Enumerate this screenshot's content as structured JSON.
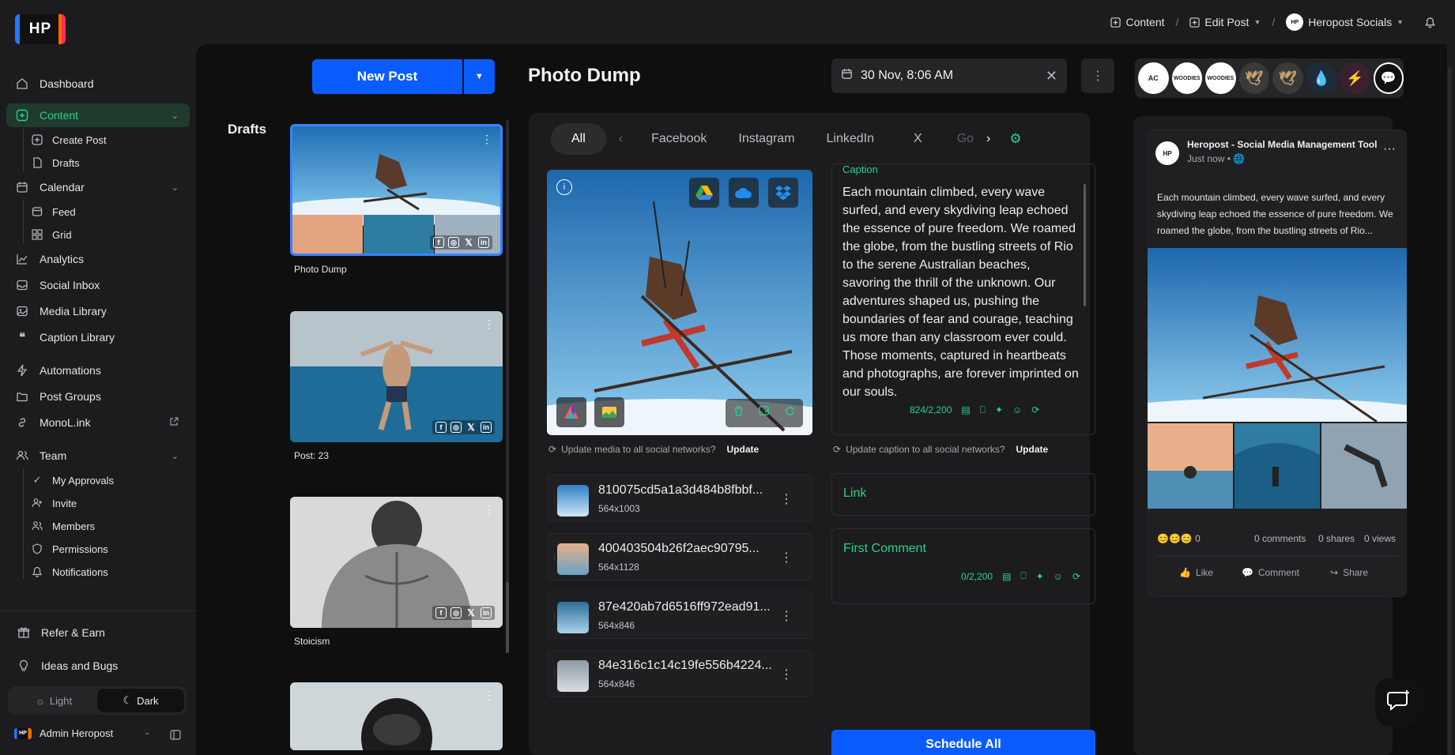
{
  "logo": "HP",
  "header": {
    "crumbs": [
      "Content",
      "Edit Post",
      "Heropost Socials"
    ]
  },
  "sidebar": {
    "items": [
      {
        "label": "Dashboard"
      },
      {
        "label": "Content"
      },
      {
        "label": "Create Post"
      },
      {
        "label": "Drafts"
      },
      {
        "label": "Calendar"
      },
      {
        "label": "Feed"
      },
      {
        "label": "Grid"
      },
      {
        "label": "Analytics"
      },
      {
        "label": "Social Inbox"
      },
      {
        "label": "Media Library"
      },
      {
        "label": "Caption Library"
      },
      {
        "label": "Automations"
      },
      {
        "label": "Post Groups"
      },
      {
        "label": "MonoL.ink"
      },
      {
        "label": "Team"
      },
      {
        "label": "My Approvals"
      },
      {
        "label": "Invite"
      },
      {
        "label": "Members"
      },
      {
        "label": "Permissions"
      },
      {
        "label": "Notifications"
      },
      {
        "label": "Refer & Earn"
      },
      {
        "label": "Ideas and Bugs"
      }
    ],
    "theme": {
      "light": "Light",
      "dark": "Dark"
    },
    "user": {
      "name": "Admin Heropost",
      "badge": "HP"
    }
  },
  "toolbar": {
    "new_post": "New Post",
    "post_title": "Photo Dump",
    "date": "30 Nov, 8:06 AM"
  },
  "drafts": {
    "title": "Drafts",
    "items": [
      {
        "label": "Photo Dump"
      },
      {
        "label": "Post: 23"
      },
      {
        "label": "Stoicism"
      }
    ]
  },
  "avatars": [
    "AC",
    "WOODIES",
    "WOODIES",
    "",
    "",
    "",
    "",
    ""
  ],
  "tabs": [
    "All",
    "Facebook",
    "Instagram",
    "LinkedIn",
    "X",
    "Go"
  ],
  "media": {
    "update_prompt": "Update media to all social networks?",
    "update_label": "Update",
    "items": [
      {
        "name": "810075cd5a1a3d484b8fbbf...",
        "dims": "564x1003"
      },
      {
        "name": "400403504b26f2aec90795...",
        "dims": "564x1128"
      },
      {
        "name": "87e420ab7d6516ff972ead91...",
        "dims": "564x846"
      },
      {
        "name": "84e316c1c14c19fe556b4224...",
        "dims": "564x846"
      }
    ]
  },
  "caption": {
    "label": "Caption",
    "text": "Each mountain climbed, every wave surfed, and every skydiving leap echoed the essence of pure freedom. We roamed the globe, from the bustling streets of Rio to the serene Australian beaches, savoring the thrill of the unknown. Our adventures shaped us, pushing the boundaries of fear and courage, teaching us more than any classroom ever could. Those moments, captured in heartbeats and photographs, are forever imprinted on our souls.",
    "count": "824/2,200",
    "update_prompt": "Update caption to all social networks?",
    "update_label": "Update"
  },
  "link": {
    "label": "Link"
  },
  "first_comment": {
    "label": "First Comment",
    "count": "0/2,200"
  },
  "schedule": "Schedule All",
  "preview": {
    "account": "Heropost - Social Media Management Tool",
    "time": "Just now •",
    "text": "Each mountain climbed, every wave surfed, and every skydiving leap echoed the essence of pure freedom. We roamed the globe, from the bustling streets of Rio...",
    "reactions": "0",
    "comments": "0 comments",
    "shares": "0 shares",
    "views": "0 views",
    "like": "Like",
    "comment": "Comment",
    "share": "Share"
  },
  "colors": {
    "accent": "#27d28a",
    "primary": "#0a5cff"
  }
}
